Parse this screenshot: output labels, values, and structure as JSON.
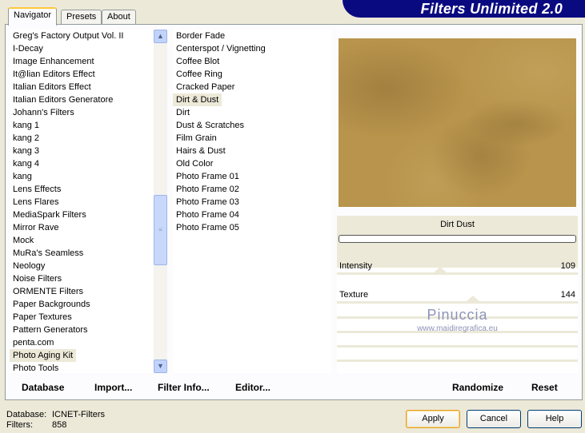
{
  "title": "Filters Unlimited 2.0",
  "tabs": [
    "Navigator",
    "Presets",
    "About"
  ],
  "categories": [
    "Greg's Factory Output Vol. II",
    "I-Decay",
    "Image Enhancement",
    "It@lian Editors Effect",
    "Italian Editors Effect",
    "Italian Editors Generatore",
    "Johann's Filters",
    "kang 1",
    "kang 2",
    "kang 3",
    "kang 4",
    "kang",
    "Lens Effects",
    "Lens Flares",
    "MediaSpark Filters",
    "Mirror Rave",
    "Mock",
    "MuRa's Seamless",
    "Neology",
    "Noise Filters",
    "ORMENTE Filters",
    "Paper Backgrounds",
    "Paper Textures",
    "Pattern Generators",
    "penta.com",
    "Photo Aging Kit",
    "Photo Tools"
  ],
  "selected_category": "Photo Aging Kit",
  "filters": [
    "Border Fade",
    "Centerspot / Vignetting",
    "Coffee Blot",
    "Coffee Ring",
    "Cracked Paper",
    "Dirt & Dust",
    "Dirt",
    "Dust & Scratches",
    "Film Grain",
    "Hairs & Dust",
    "Old Color",
    "Photo Frame 01",
    "Photo Frame 02",
    "Photo Frame 03",
    "Photo Frame 04",
    "Photo Frame 05"
  ],
  "selected_filter": "Dirt & Dust",
  "filter_title": "Dirt  Dust",
  "params": [
    {
      "label": "Intensity",
      "value": 109,
      "max": 255
    },
    {
      "label": "Texture",
      "value": 144,
      "max": 255
    }
  ],
  "watermark": {
    "name": "Pinuccia",
    "url": "www.maidiregrafica.eu"
  },
  "buttons": {
    "database": "Database",
    "import": "Import...",
    "filter_info": "Filter Info...",
    "editor": "Editor...",
    "randomize": "Randomize",
    "reset": "Reset",
    "apply": "Apply",
    "cancel": "Cancel",
    "help": "Help"
  },
  "status": {
    "database_label": "Database:",
    "database_value": "ICNET-Filters",
    "filters_label": "Filters:",
    "filters_value": "858"
  },
  "colors": {
    "banner": "#0a0a80",
    "preview": "#b8944c"
  }
}
